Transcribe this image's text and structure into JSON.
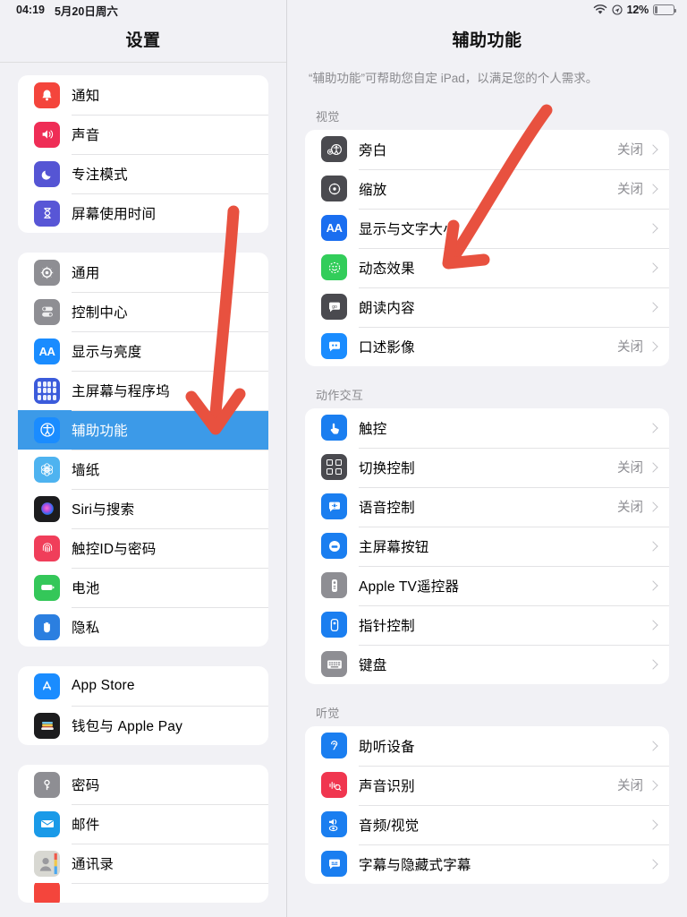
{
  "status_bar": {
    "time": "04:19",
    "date": "5月20日周六",
    "battery_percent": "12%",
    "wifi_icon": "wifi-icon",
    "location_icon": "location-icon",
    "battery_icon": "battery-icon"
  },
  "colors": {
    "selection_blue": "#3c9ae8",
    "background": "#f1f1f5",
    "card": "#ffffff",
    "secondary_text": "#8e8e93",
    "annotation_red": "#e8513f"
  },
  "sidebar": {
    "title": "设置",
    "groups": [
      {
        "items": [
          {
            "label": "通知",
            "icon": "bell-icon",
            "icon_color": "#f4453c",
            "selected": false
          },
          {
            "label": "声音",
            "icon": "speaker-icon",
            "icon_color": "#ef2d56",
            "selected": false
          },
          {
            "label": "专注模式",
            "icon": "moon-icon",
            "icon_color": "#5555d4",
            "selected": false
          },
          {
            "label": "屏幕使用时间",
            "icon": "hourglass-icon",
            "icon_color": "#5856d6",
            "selected": false
          }
        ]
      },
      {
        "items": [
          {
            "label": "通用",
            "icon": "gear-icon",
            "icon_color": "#8e8e93",
            "selected": false
          },
          {
            "label": "控制中心",
            "icon": "toggles-icon",
            "icon_color": "#8e8e93",
            "selected": false
          },
          {
            "label": "显示与亮度",
            "icon": "aa-icon",
            "icon_color": "#1a8cff",
            "selected": false
          },
          {
            "label": "主屏幕与程序坞",
            "icon": "home-screen-icon",
            "icon_color": "#3b5bdb",
            "selected": false
          },
          {
            "label": "辅助功能",
            "icon": "accessibility-icon",
            "icon_color": "#1a8cff",
            "selected": true
          },
          {
            "label": "墙纸",
            "icon": "wallpaper-icon",
            "icon_color": "#4eb3f0",
            "selected": false
          },
          {
            "label": "Siri与搜索",
            "icon": "siri-icon",
            "icon_color": "#1c1c1e",
            "selected": false
          },
          {
            "label": "触控ID与密码",
            "icon": "fingerprint-icon",
            "icon_color": "#f03e5a",
            "selected": false
          },
          {
            "label": "电池",
            "icon": "battery-icon",
            "icon_color": "#34c759",
            "selected": false
          },
          {
            "label": "隐私",
            "icon": "hand-icon",
            "icon_color": "#2b7fe0",
            "selected": false
          }
        ]
      },
      {
        "items": [
          {
            "label": "App Store",
            "icon": "app-store-icon",
            "icon_color": "#1a8cff",
            "selected": false
          },
          {
            "label": "钱包与 Apple Pay",
            "icon": "wallet-icon",
            "icon_color": "#1c1c1e",
            "selected": false
          }
        ]
      },
      {
        "items": [
          {
            "label": "密码",
            "icon": "key-icon",
            "icon_color": "#8e8e93",
            "selected": false
          },
          {
            "label": "邮件",
            "icon": "mail-icon",
            "icon_color": "#1a9ae8",
            "selected": false
          },
          {
            "label": "通讯录",
            "icon": "contacts-icon",
            "icon_color": "#c7c7cc",
            "selected": false
          }
        ]
      }
    ]
  },
  "detail": {
    "title": "辅助功能",
    "intro": "“辅助功能”可帮助您自定 iPad，以满足您的个人需求。",
    "sections": [
      {
        "header": "视觉",
        "items": [
          {
            "label": "旁白",
            "value": "关闭",
            "icon": "voiceover-icon",
            "icon_color": "#4a4a4f"
          },
          {
            "label": "缩放",
            "value": "关闭",
            "icon": "zoom-icon",
            "icon_color": "#4a4a4f"
          },
          {
            "label": "显示与文字大小",
            "value": "",
            "icon": "aa-icon",
            "icon_color": "#1a6ef0"
          },
          {
            "label": "动态效果",
            "value": "",
            "icon": "motion-icon",
            "icon_color": "#32cd5a"
          },
          {
            "label": "朗读内容",
            "value": "",
            "icon": "spoken-content-icon",
            "icon_color": "#4a4a4f"
          },
          {
            "label": "口述影像",
            "value": "关闭",
            "icon": "audio-description-icon",
            "icon_color": "#1a8cff"
          }
        ]
      },
      {
        "header": "动作交互",
        "items": [
          {
            "label": "触控",
            "value": "",
            "icon": "touch-icon",
            "icon_color": "#1a7ef0"
          },
          {
            "label": "切换控制",
            "value": "关闭",
            "icon": "switch-control-icon",
            "icon_color": "#4a4a4f"
          },
          {
            "label": "语音控制",
            "value": "关闭",
            "icon": "voice-control-icon",
            "icon_color": "#1a7ef0"
          },
          {
            "label": "主屏幕按钮",
            "value": "",
            "icon": "home-button-icon",
            "icon_color": "#1a7ef0"
          },
          {
            "label": "Apple TV遥控器",
            "value": "",
            "icon": "apple-tv-remote-icon",
            "icon_color": "#8e8e93"
          },
          {
            "label": "指针控制",
            "value": "",
            "icon": "pointer-control-icon",
            "icon_color": "#1a7ef0"
          },
          {
            "label": "键盘",
            "value": "",
            "icon": "keyboard-icon",
            "icon_color": "#8e8e93"
          }
        ]
      },
      {
        "header": "听觉",
        "items": [
          {
            "label": "助听设备",
            "value": "",
            "icon": "hearing-devices-icon",
            "icon_color": "#1a7ef0"
          },
          {
            "label": "声音识别",
            "value": "关闭",
            "icon": "sound-recognition-icon",
            "icon_color": "#f0364f"
          },
          {
            "label": "音频/视觉",
            "value": "",
            "icon": "audio-visual-icon",
            "icon_color": "#1a7ef0"
          },
          {
            "label": "字幕与隐藏式字幕",
            "value": "",
            "icon": "captions-icon",
            "icon_color": "#1a7ef0"
          }
        ]
      }
    ]
  },
  "annotations": [
    {
      "name": "arrow-to-accessibility-row",
      "color": "#e8513f"
    },
    {
      "name": "arrow-to-display-text-size-row",
      "color": "#e8513f"
    }
  ]
}
